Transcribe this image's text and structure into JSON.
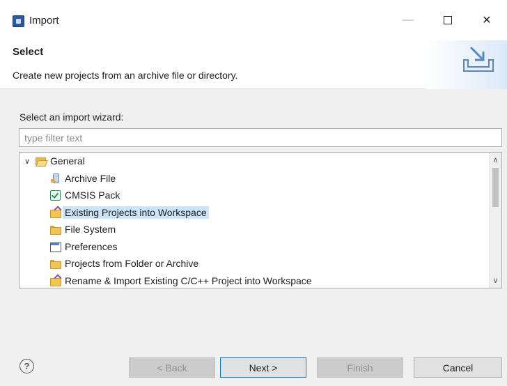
{
  "window": {
    "title": "Import",
    "controls": {
      "minimize": "—",
      "close": "✕"
    }
  },
  "header": {
    "title": "Select",
    "description": "Create new projects from an archive file or directory."
  },
  "wizard": {
    "label": "Select an import wizard:",
    "filter_placeholder": "type filter text",
    "filter_value": ""
  },
  "tree": {
    "group": {
      "label": "General",
      "expanded": true,
      "icon": "folder-open-icon"
    },
    "items": [
      {
        "label": "Archive File",
        "icon": "archive-icon",
        "selected": false
      },
      {
        "label": "CMSIS Pack",
        "icon": "checkbox-icon",
        "selected": false
      },
      {
        "label": "Existing Projects into Workspace",
        "icon": "import-folder-icon",
        "selected": true
      },
      {
        "label": "File System",
        "icon": "folder-icon",
        "selected": false
      },
      {
        "label": "Preferences",
        "icon": "preferences-icon",
        "selected": false
      },
      {
        "label": "Projects from Folder or Archive",
        "icon": "folder-icon",
        "selected": false
      },
      {
        "label": "Rename & Import Existing C/C++ Project into Workspace",
        "icon": "import-folder-icon",
        "selected": false
      }
    ],
    "expand_glyph": "∨",
    "scroll_up_glyph": "∧",
    "scroll_down_glyph": "∨"
  },
  "footer": {
    "help_glyph": "?",
    "back_label": "< Back",
    "next_label": "Next >",
    "finish_label": "Finish",
    "cancel_label": "Cancel"
  },
  "colors": {
    "selection": "#cce4f7",
    "default_button_border": "#0078d7"
  }
}
